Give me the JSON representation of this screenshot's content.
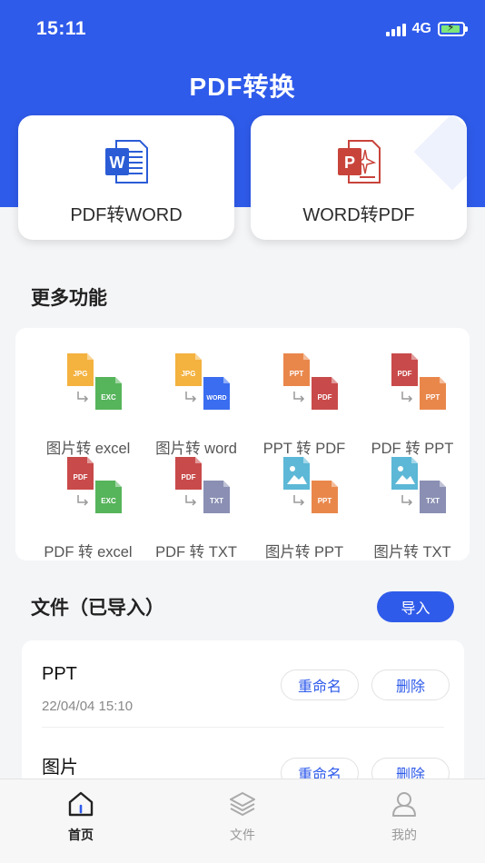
{
  "status_bar": {
    "time": "15:11",
    "network": "4G"
  },
  "header": {
    "title": "PDF转换"
  },
  "convert_cards": [
    {
      "label": "PDF转WORD",
      "icon": "word-doc-icon",
      "color": "#2b5cd6"
    },
    {
      "label": "WORD转PDF",
      "icon": "powerpoint-doc-icon",
      "color": "#c8443b"
    }
  ],
  "features": {
    "title": "更多功能",
    "items": [
      {
        "label": "图片转 excel",
        "from": "JPG",
        "to": "EXC",
        "from_color": "#f4b23f",
        "to_color": "#56b45b"
      },
      {
        "label": "图片转 word",
        "from": "JPG",
        "to": "WORD",
        "from_color": "#f4b23f",
        "to_color": "#3a6df0"
      },
      {
        "label": "PPT 转 PDF",
        "from": "PPT",
        "to": "PDF",
        "from_color": "#e9874b",
        "to_color": "#c94a4a"
      },
      {
        "label": "PDF 转 PPT",
        "from": "PDF",
        "to": "PPT",
        "from_color": "#c94a4a",
        "to_color": "#e9874b"
      },
      {
        "label": "PDF 转 excel",
        "from": "PDF",
        "to": "EXC",
        "from_color": "#c94a4a",
        "to_color": "#56b45b"
      },
      {
        "label": "PDF 转 TXT",
        "from": "PDF",
        "to": "TXT",
        "from_color": "#c94a4a",
        "to_color": "#8a8fb3"
      },
      {
        "label": "图片转 PPT",
        "from": "IMG",
        "to": "PPT",
        "from_color": "#5cb8d6",
        "to_color": "#e9874b"
      },
      {
        "label": "图片转 TXT",
        "from": "IMG",
        "to": "TXT",
        "from_color": "#5cb8d6",
        "to_color": "#8a8fb3"
      }
    ]
  },
  "files": {
    "title": "文件（已导入）",
    "import_label": "导入",
    "rename_label": "重命名",
    "delete_label": "删除",
    "items": [
      {
        "name": "PPT",
        "time": "22/04/04 15:10"
      },
      {
        "name": "图片",
        "time": ""
      }
    ]
  },
  "tab_bar": {
    "tabs": [
      {
        "label": "首页",
        "icon": "home-icon",
        "active": true
      },
      {
        "label": "文件",
        "icon": "layers-icon",
        "active": false
      },
      {
        "label": "我的",
        "icon": "user-icon",
        "active": false
      }
    ]
  },
  "colors": {
    "primary": "#2f5bea",
    "background": "#f4f5f7"
  }
}
